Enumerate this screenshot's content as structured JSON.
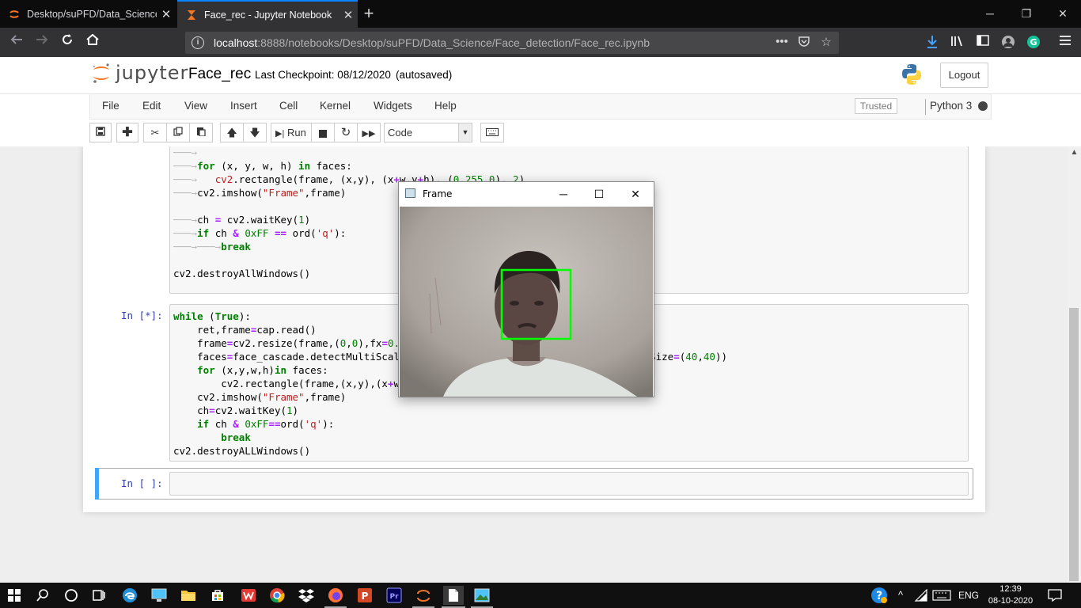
{
  "browser": {
    "tabs": [
      {
        "title": "Desktop/suPFD/Data_Science/F",
        "active": false
      },
      {
        "title": "Face_rec - Jupyter Notebook",
        "active": true
      }
    ],
    "url_host": "localhost",
    "url_rest": ":8888/notebooks/Desktop/suPFD/Data_Science/Face_detection/Face_rec.ipynb",
    "accent_color": "#0a84ff"
  },
  "jupyter": {
    "logo_text": "jupyter",
    "notebook_name": "Face_rec",
    "checkpoint": "Last Checkpoint: 08/12/2020",
    "autosave": "(autosaved)",
    "logout_label": "Logout",
    "menu": [
      "File",
      "Edit",
      "View",
      "Insert",
      "Cell",
      "Kernel",
      "Widgets",
      "Help"
    ],
    "trusted_label": "Trusted",
    "kernel_name": "Python 3",
    "toolbar": {
      "run_label": "Run",
      "cell_type": "Code"
    }
  },
  "cells": {
    "prompt_running": "In [*]:",
    "prompt_empty": "In [ ]:"
  },
  "frame_window": {
    "title": "Frame"
  },
  "taskbar": {
    "language": "ENG",
    "time": "12:39",
    "date": "08-10-2020"
  }
}
